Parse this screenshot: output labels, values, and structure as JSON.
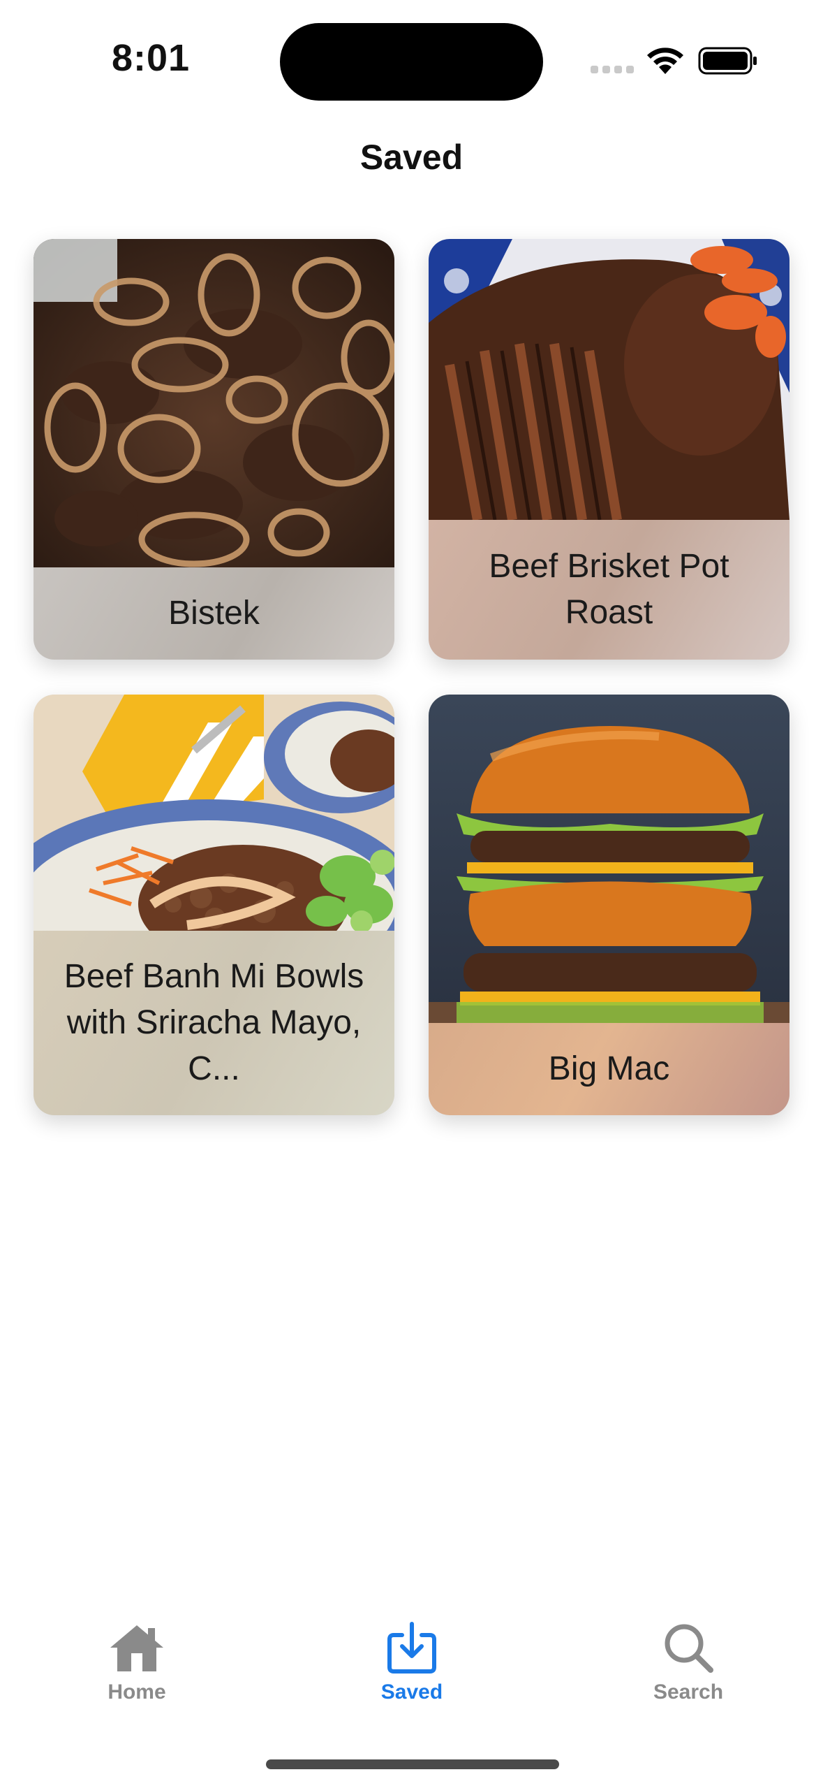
{
  "status_bar": {
    "time": "8:01"
  },
  "header": {
    "title": "Saved"
  },
  "cards": [
    {
      "title": "Bistek"
    },
    {
      "title": "Beef Brisket Pot Roast"
    },
    {
      "title": "Beef Banh Mi Bowls with Sriracha Mayo, C..."
    },
    {
      "title": "Big Mac"
    }
  ],
  "tab_bar": {
    "tabs": [
      {
        "label": "Home",
        "icon": "house-icon",
        "active": false
      },
      {
        "label": "Saved",
        "icon": "download-tray-icon",
        "active": true
      },
      {
        "label": "Search",
        "icon": "magnifying-glass-icon",
        "active": false
      }
    ],
    "active_color": "#1a7ae8",
    "inactive_color": "#8a8a8a"
  }
}
